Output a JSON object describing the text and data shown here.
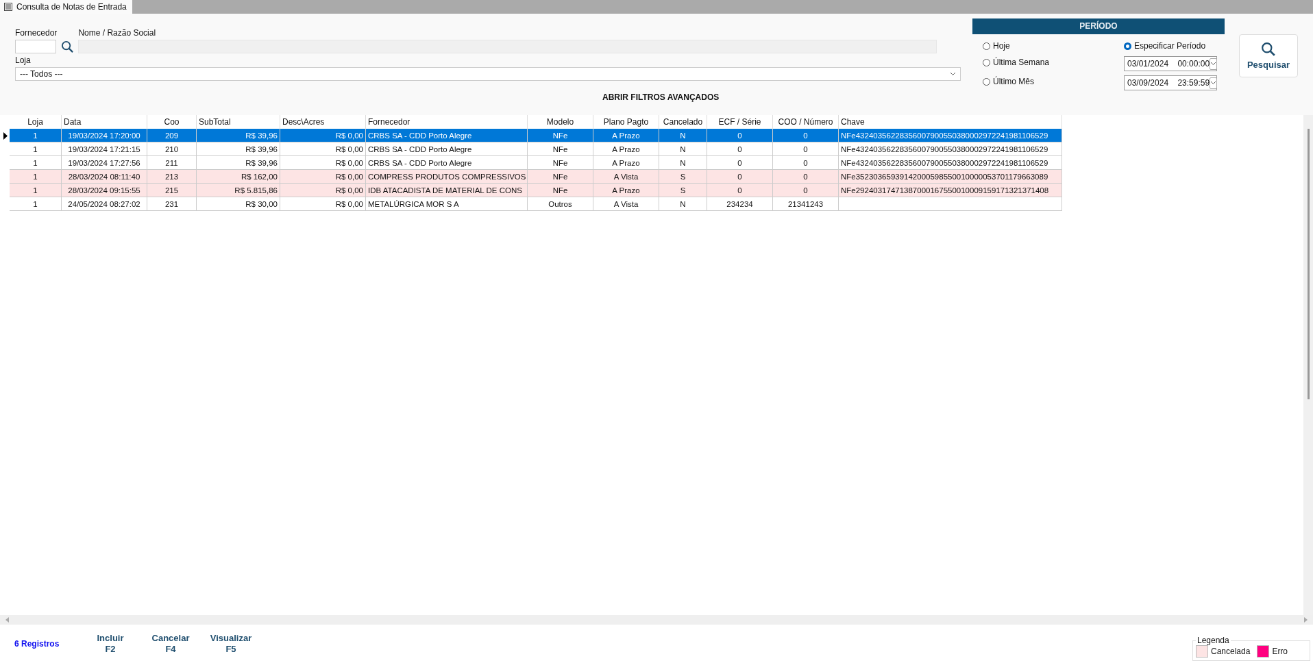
{
  "window": {
    "tab": "Consulta de Notas de Entrada"
  },
  "filters": {
    "fornecedor": {
      "label": "Fornecedor"
    },
    "nome": {
      "label": "Nome / Razão Social"
    },
    "loja": {
      "label": "Loja",
      "value": "--- Todos ---"
    },
    "advanced": "ABRIR FILTROS AVANÇADOS"
  },
  "period": {
    "title": "PERÍODO",
    "options": [
      {
        "label": "Hoje",
        "selected": false
      },
      {
        "label": "Última Semana",
        "selected": false
      },
      {
        "label": "Último Mês",
        "selected": false
      },
      {
        "label": "Especificar Período",
        "selected": true
      }
    ],
    "start": "03/01/2024    00:00:00",
    "end": "03/09/2024    23:59:59"
  },
  "search_button": "Pesquisar",
  "table": {
    "columns": [
      {
        "label": "Loja"
      },
      {
        "label": "Data"
      },
      {
        "label": "Coo"
      },
      {
        "label": "SubTotal"
      },
      {
        "label": "Desc\\Acres"
      },
      {
        "label": "Fornecedor"
      },
      {
        "label": "Modelo"
      },
      {
        "label": "Plano Pagto"
      },
      {
        "label": "Cancelado"
      },
      {
        "label": "ECF / Série"
      },
      {
        "label": "COO / Número"
      },
      {
        "label": "Chave"
      }
    ],
    "rows": [
      {
        "selected": true,
        "kind": "normal",
        "cells": [
          "1",
          "19/03/2024 17:20:00",
          "209",
          "R$ 39,96",
          "R$ 0,00",
          "CRBS SA - CDD Porto Alegre",
          "NFe",
          "A Prazo",
          "N",
          "0",
          "0",
          "NFe43240356228356007900550380002972241981106529"
        ]
      },
      {
        "selected": false,
        "kind": "normal",
        "cells": [
          "1",
          "19/03/2024 17:21:15",
          "210",
          "R$ 39,96",
          "R$ 0,00",
          "CRBS SA - CDD Porto Alegre",
          "NFe",
          "A Prazo",
          "N",
          "0",
          "0",
          "NFe43240356228356007900550380002972241981106529"
        ]
      },
      {
        "selected": false,
        "kind": "normal",
        "cells": [
          "1",
          "19/03/2024 17:27:56",
          "211",
          "R$ 39,96",
          "R$ 0,00",
          "CRBS SA - CDD Porto Alegre",
          "NFe",
          "A Prazo",
          "N",
          "0",
          "0",
          "NFe43240356228356007900550380002972241981106529"
        ]
      },
      {
        "selected": false,
        "kind": "cancelada",
        "cells": [
          "1",
          "28/03/2024 08:11:40",
          "213",
          "R$ 162,00",
          "R$ 0,00",
          "COMPRESS PRODUTOS COMPRESSIVOS",
          "NFe",
          "A Vista",
          "S",
          "0",
          "0",
          "NFe35230365939142000598550010000053701179663089"
        ]
      },
      {
        "selected": false,
        "kind": "cancelada",
        "cells": [
          "1",
          "28/03/2024 09:15:55",
          "215",
          "R$ 5.815,86",
          "R$ 0,00",
          "IDB ATACADISTA DE MATERIAL DE CONS",
          "NFe",
          "A Prazo",
          "S",
          "0",
          "0",
          "NFe29240317471387000167550010009159171321371408"
        ]
      },
      {
        "selected": false,
        "kind": "normal",
        "cells": [
          "1",
          "24/05/2024 08:27:02",
          "231",
          "R$ 30,00",
          "R$ 0,00",
          "METALÚRGICA MOR S A",
          "Outros",
          "A Vista",
          "N",
          "234234",
          "21341243",
          ""
        ]
      }
    ]
  },
  "footer": {
    "count": "6 Registros",
    "actions": [
      {
        "label": "Incluir",
        "key": "F2"
      },
      {
        "label": "Cancelar",
        "key": "F4"
      },
      {
        "label": "Visualizar",
        "key": "F5"
      }
    ]
  },
  "legend": {
    "title": "Legenda",
    "items": [
      {
        "label": "Cancelada",
        "color": "#fde4e4"
      },
      {
        "label": "Erro",
        "color": "#ff0080"
      }
    ]
  }
}
